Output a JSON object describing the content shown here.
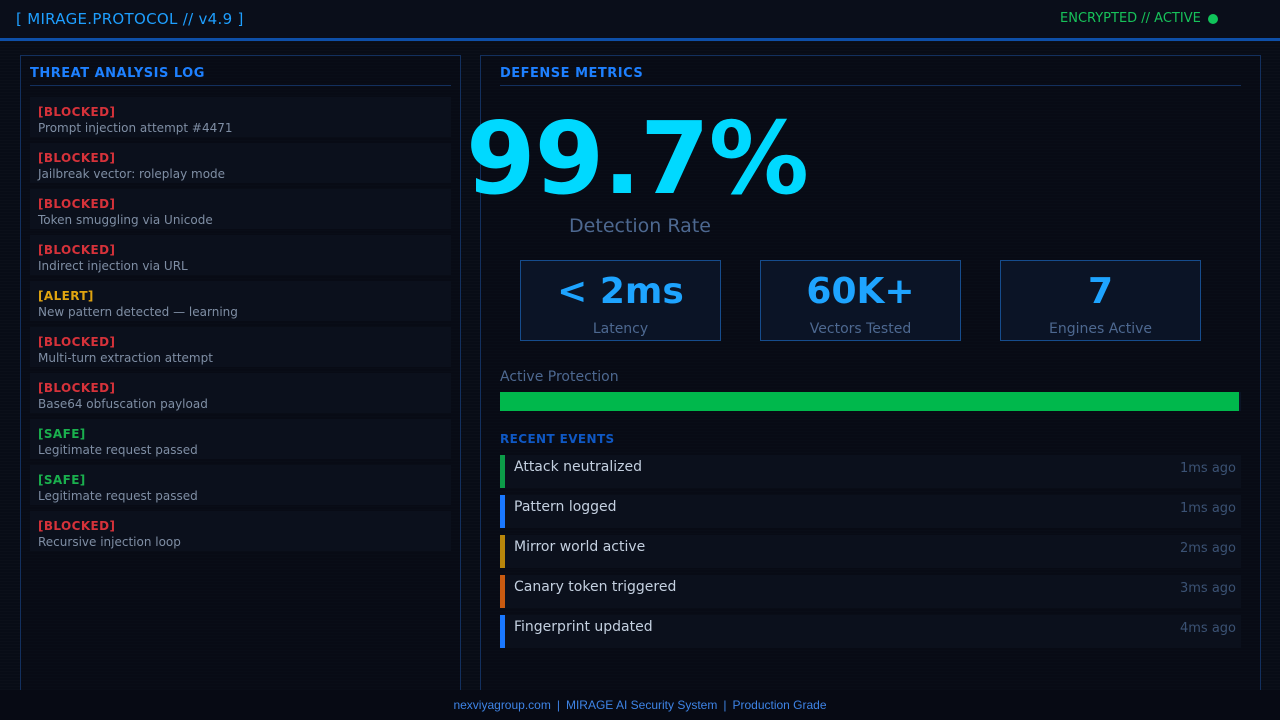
{
  "header": {
    "brand": "[ MIRAGE.PROTOCOL // v4.9 ]",
    "status": "ENCRYPTED // ACTIVE",
    "status_color": "#10c45a"
  },
  "threat_log": {
    "title": "THREAT ANALYSIS LOG",
    "items": [
      {
        "tag": "[BLOCKED]",
        "type": "blocked",
        "text": "Prompt injection attempt #4471"
      },
      {
        "tag": "[BLOCKED]",
        "type": "blocked",
        "text": "Jailbreak vector: roleplay mode"
      },
      {
        "tag": "[BLOCKED]",
        "type": "blocked",
        "text": "Token smuggling via Unicode"
      },
      {
        "tag": "[BLOCKED]",
        "type": "blocked",
        "text": "Indirect injection via URL"
      },
      {
        "tag": "[ALERT]",
        "type": "alert",
        "text": "New pattern detected — learning"
      },
      {
        "tag": "[BLOCKED]",
        "type": "blocked",
        "text": "Multi-turn extraction attempt"
      },
      {
        "tag": "[BLOCKED]",
        "type": "blocked",
        "text": "Base64 obfuscation payload"
      },
      {
        "tag": "[SAFE]",
        "type": "safe",
        "text": "Legitimate request passed"
      },
      {
        "tag": "[SAFE]",
        "type": "safe",
        "text": "Legitimate request passed"
      },
      {
        "tag": "[BLOCKED]",
        "type": "blocked",
        "text": "Recursive injection loop"
      }
    ]
  },
  "metrics": {
    "title": "DEFENSE METRICS",
    "detection_rate": "99.7%",
    "detection_label": "Detection Rate",
    "stats": [
      {
        "value": "< 2ms",
        "label": "Latency"
      },
      {
        "value": "60K+",
        "label": "Vectors Tested"
      },
      {
        "value": "7",
        "label": "Engines Active"
      }
    ],
    "protection_label": "Active Protection",
    "protection_level": 0.997
  },
  "events": {
    "title": "RECENT EVENTS",
    "items": [
      {
        "text": "Attack neutralized",
        "time": "1ms ago",
        "color": "#0c9c48"
      },
      {
        "text": "Pattern logged",
        "time": "1ms ago",
        "color": "#1a78ff"
      },
      {
        "text": "Mirror world active",
        "time": "2ms ago",
        "color": "#b8860b"
      },
      {
        "text": "Canary token triggered",
        "time": "3ms ago",
        "color": "#c85a10"
      },
      {
        "text": "Fingerprint updated",
        "time": "4ms ago",
        "color": "#1a78ff"
      }
    ]
  },
  "footer": {
    "domain": "nexviyagroup.com",
    "system": "MIRAGE AI Security System",
    "grade": "Production Grade"
  }
}
